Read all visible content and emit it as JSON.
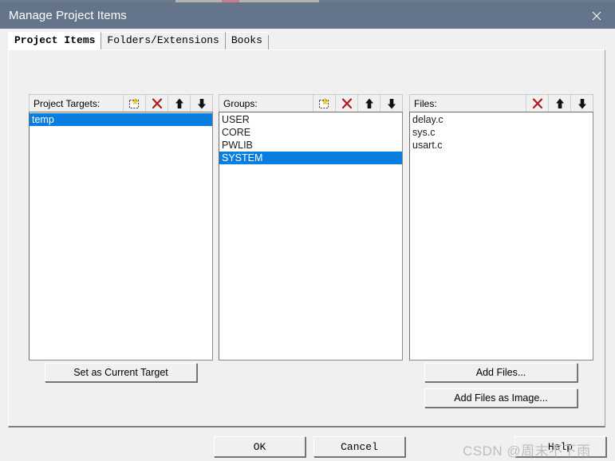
{
  "window": {
    "title": "Manage Project Items",
    "close_icon": "close-icon"
  },
  "tabs": [
    {
      "label": "Project Items",
      "active": true
    },
    {
      "label": "Folders/Extensions",
      "active": false
    },
    {
      "label": "Books",
      "active": false
    }
  ],
  "columns": {
    "targets": {
      "label": "Project Targets:",
      "tools": [
        "new-item-icon",
        "delete-icon",
        "move-up-icon",
        "move-down-icon"
      ],
      "items": [
        {
          "label": "temp",
          "selected": true
        }
      ]
    },
    "groups": {
      "label": "Groups:",
      "tools": [
        "new-item-icon",
        "delete-icon",
        "move-up-icon",
        "move-down-icon"
      ],
      "items": [
        {
          "label": "USER",
          "selected": false
        },
        {
          "label": "CORE",
          "selected": false
        },
        {
          "label": "PWLIB",
          "selected": false
        },
        {
          "label": "SYSTEM",
          "selected": true
        }
      ]
    },
    "files": {
      "label": "Files:",
      "tools": [
        "delete-icon",
        "move-up-icon",
        "move-down-icon"
      ],
      "items": [
        {
          "label": "delay.c",
          "selected": false
        },
        {
          "label": "sys.c",
          "selected": false
        },
        {
          "label": "usart.c",
          "selected": false
        }
      ]
    }
  },
  "actions": {
    "set_current_target": "Set as Current Target",
    "add_files": "Add Files...",
    "add_files_as_image": "Add Files as Image..."
  },
  "footer": {
    "ok": "OK",
    "cancel": "Cancel",
    "help": "Help"
  },
  "watermark": {
    "text": "CSDN @周末不下雨"
  },
  "colors": {
    "titlebar": "#64748b",
    "selection": "#0a7ee0",
    "dialog_bg": "#f0f0f0",
    "delete_icon": "#b01a1a"
  }
}
